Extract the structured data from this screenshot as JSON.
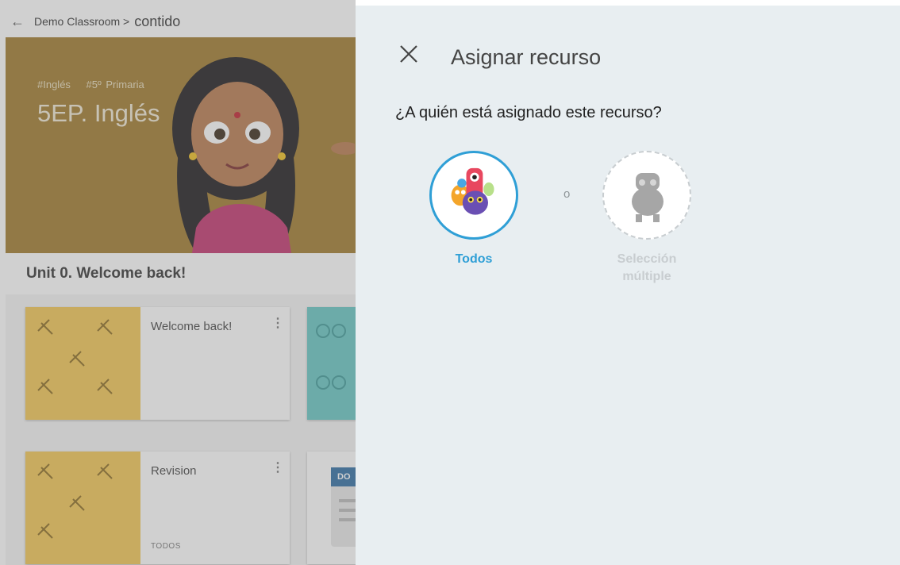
{
  "breadcrumb": {
    "parent": "Demo Classroom >",
    "current": "contido"
  },
  "hero": {
    "tags": [
      "#Inglés",
      "#5º Primaria"
    ],
    "title": "5EP. Inglés"
  },
  "unit": {
    "title": "Unit 0. Welcome back!"
  },
  "cards": [
    {
      "title": "Welcome back!",
      "menu": "⋮",
      "label": ""
    },
    {
      "title": "Revision",
      "menu": "⋮",
      "label": "TODOS"
    }
  ],
  "doc_card": {
    "badge": "DO"
  },
  "panel": {
    "title": "Asignar recurso",
    "question": "¿A quién está asignado este recurso?",
    "or_text": "o",
    "options": [
      {
        "label": "Todos",
        "state": "selected"
      },
      {
        "label": "Selección múltiple",
        "state": "unselected"
      }
    ]
  },
  "colors": {
    "accent": "#2f9fd6",
    "panel_bg": "#e8eef1",
    "hero_bg": "#a07a2b"
  },
  "icons": {
    "back": "arrow-left-icon",
    "close": "close-icon",
    "more": "more-vertical-icon"
  }
}
